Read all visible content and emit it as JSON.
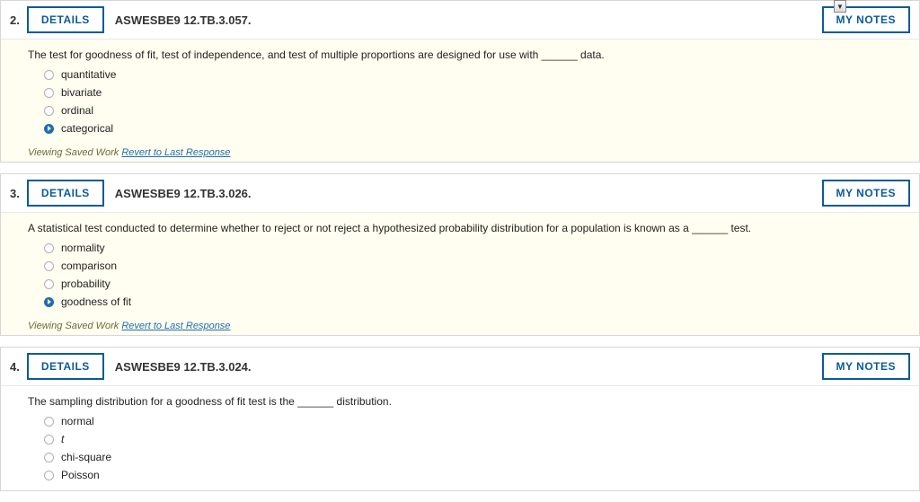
{
  "labels": {
    "details": "DETAILS",
    "mynotes": "MY NOTES",
    "viewing": "Viewing Saved Work",
    "revert": "Revert to Last Response"
  },
  "questions": [
    {
      "number": "2.",
      "code": "ASWESBE9 12.TB.3.057.",
      "prompt": "The test for goodness of fit, test of independence, and test of multiple proportions are designed for use with ______ data.",
      "choices": [
        {
          "label": "quantitative",
          "selected": false
        },
        {
          "label": "bivariate",
          "selected": false
        },
        {
          "label": "ordinal",
          "selected": false
        },
        {
          "label": "categorical",
          "selected": true
        }
      ],
      "showSaved": true
    },
    {
      "number": "3.",
      "code": "ASWESBE9 12.TB.3.026.",
      "prompt": "A statistical test conducted to determine whether to reject or not reject a hypothesized probability distribution for a population is known as a ______ test.",
      "choices": [
        {
          "label": "normality",
          "selected": false
        },
        {
          "label": "comparison",
          "selected": false
        },
        {
          "label": "probability",
          "selected": false
        },
        {
          "label": "goodness of fit",
          "selected": true
        }
      ],
      "showSaved": true
    },
    {
      "number": "4.",
      "code": "ASWESBE9 12.TB.3.024.",
      "prompt": "The sampling distribution for a goodness of fit test is the ______ distribution.",
      "choices": [
        {
          "label": "normal",
          "selected": false
        },
        {
          "label": "t",
          "selected": false
        },
        {
          "label": "chi-square",
          "selected": false
        },
        {
          "label": "Poisson",
          "selected": false
        }
      ],
      "showSaved": false
    }
  ]
}
